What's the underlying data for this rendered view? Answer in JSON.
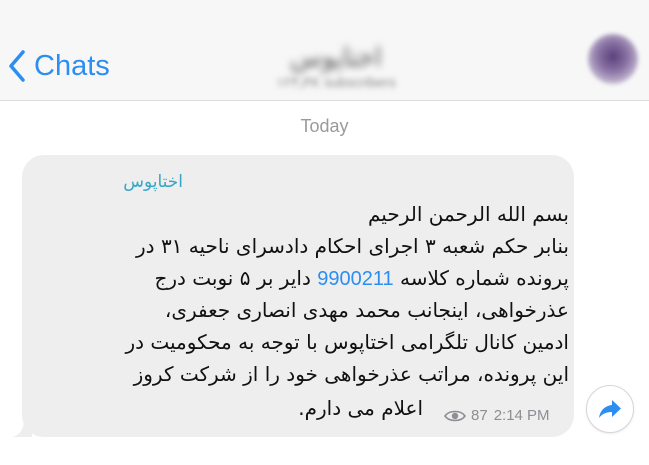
{
  "navbar": {
    "back_label": "Chats",
    "channel_title": "اختاپوس",
    "channel_subtitle": "۱۲۳٫۴K subscribers"
  },
  "chat": {
    "date_separator": "Today",
    "message": {
      "channel_name": "اختاپوس",
      "lines": [
        "بسم الله الرحمن الرحیم",
        "بنابر حکم شعبه ۳ اجرای احکام دادسرای ناحیه ۳۱ در",
        "پرونده شماره کلاسه",
        "دایر بر ۵ نوبت درج",
        "عذرخواهی، اینجانب محمد مهدی انصاری جعفری،",
        "ادمین کانال تلگرامی اختاپوس با توجه به محکومیت در",
        "این پرونده، مراتب عذرخواهی خود را از شرکت کروز",
        "اعلام می دارم."
      ],
      "case_number": "9900211",
      "views": "87",
      "time": "2:14 PM"
    }
  },
  "icons": {
    "back": "chevron-left-icon",
    "views": "eye-icon",
    "share": "share-arrow-icon"
  },
  "colors": {
    "accent": "#2b8ef0",
    "channel_name": "#37a6c4",
    "bubble": "#eeeeef",
    "meta": "#8e8e93"
  }
}
